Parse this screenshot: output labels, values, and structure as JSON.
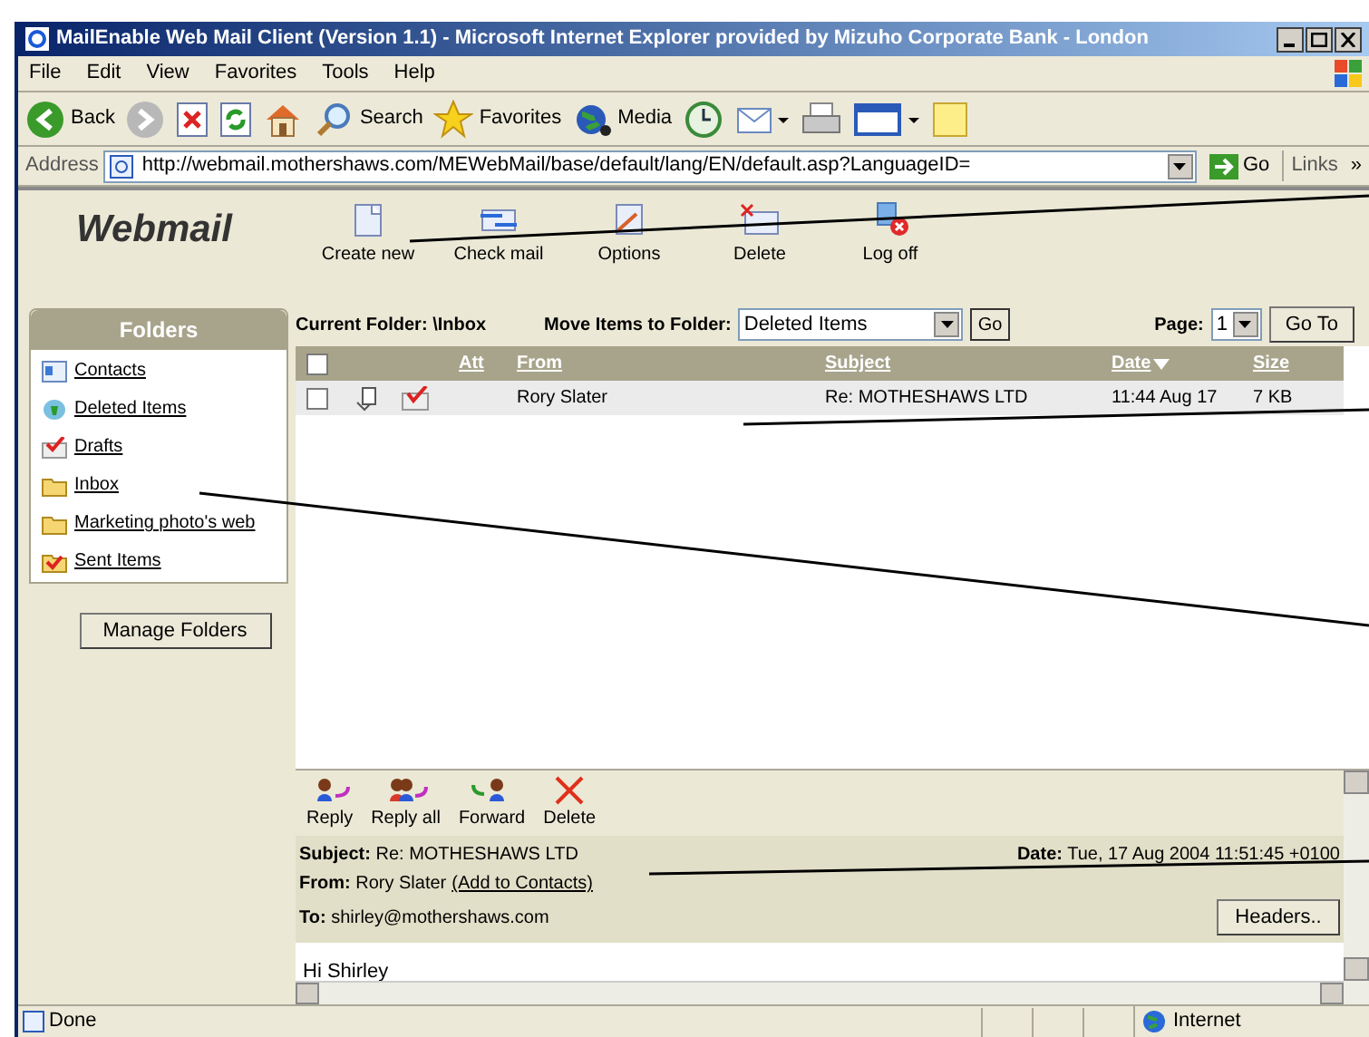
{
  "window": {
    "title": "MailEnable Web Mail Client (Version 1.1) - Microsoft Internet Explorer provided by Mizuho Corporate Bank - London"
  },
  "menu": [
    "File",
    "Edit",
    "View",
    "Favorites",
    "Tools",
    "Help"
  ],
  "toolbar": [
    {
      "kind": "back",
      "label": "Back"
    },
    {
      "kind": "forward"
    },
    {
      "kind": "stop"
    },
    {
      "kind": "refresh"
    },
    {
      "kind": "home"
    },
    {
      "kind": "search",
      "label": "Search"
    },
    {
      "kind": "favorites",
      "label": "Favorites"
    },
    {
      "kind": "media",
      "label": "Media"
    },
    {
      "kind": "history"
    },
    {
      "kind": "mail"
    },
    {
      "kind": "print"
    },
    {
      "kind": "edit"
    },
    {
      "kind": "note"
    }
  ],
  "address": {
    "label": "Address",
    "url": "http://webmail.mothershaws.com/MEWebMail/base/default/lang/EN/default.asp?LanguageID=",
    "go": "Go",
    "links": "Links",
    "more": "»"
  },
  "app": {
    "logo": "Webmail",
    "actions": [
      {
        "kind": "new",
        "label": "Create new"
      },
      {
        "kind": "check",
        "label": "Check mail"
      },
      {
        "kind": "options",
        "label": "Options"
      },
      {
        "kind": "delete",
        "label": "Delete"
      },
      {
        "kind": "logoff",
        "label": "Log off"
      }
    ],
    "folders": {
      "title": "Folders",
      "items": [
        {
          "kind": "contacts",
          "name": "Contacts"
        },
        {
          "kind": "deleted",
          "name": "Deleted Items"
        },
        {
          "kind": "drafts",
          "name": "Drafts"
        },
        {
          "kind": "folder",
          "name": "Inbox"
        },
        {
          "kind": "folder",
          "name": "Marketing photo's web"
        },
        {
          "kind": "sent",
          "name": "Sent Items"
        }
      ],
      "manage": "Manage Folders"
    },
    "list_bar": {
      "current_label": "Current Folder:",
      "current_value": "\\Inbox",
      "move_label": "Move Items to Folder:",
      "move_value": "Deleted Items",
      "go": "Go",
      "page_label": "Page:",
      "page_value": "1",
      "goto": "Go To"
    },
    "table": {
      "header_checked": false,
      "columns": [
        {
          "label": "Att",
          "sorted": false
        },
        {
          "label": "From",
          "sorted": false
        },
        {
          "label": "Subject",
          "sorted": false
        },
        {
          "label": "Date",
          "sorted": true
        },
        {
          "label": "Size",
          "sorted": false
        }
      ],
      "rows": [
        {
          "checked": false,
          "from": "Rory Slater",
          "subject": "Re: MOTHESHAWS LTD",
          "date": "11:44 Aug 17",
          "size": "7 KB"
        }
      ]
    },
    "preview": {
      "actions": [
        {
          "kind": "reply",
          "label": "Reply"
        },
        {
          "kind": "replyall",
          "label": "Reply all"
        },
        {
          "kind": "forward",
          "label": "Forward"
        },
        {
          "kind": "delete",
          "label": "Delete"
        }
      ],
      "subject_label": "Subject:",
      "subject": "Re: MOTHESHAWS LTD",
      "date_label": "Date:",
      "date": "Tue, 17 Aug 2004 11:51:45 +0100",
      "from_label": "From:",
      "from": "Rory Slater",
      "add_contact": "(Add to Contacts)",
      "to_label": "To:",
      "to": "shirley@mothershaws.com",
      "headers": "Headers..",
      "body": "Hi Shirley"
    }
  },
  "status": {
    "text": "Done",
    "zone": "Internet"
  }
}
